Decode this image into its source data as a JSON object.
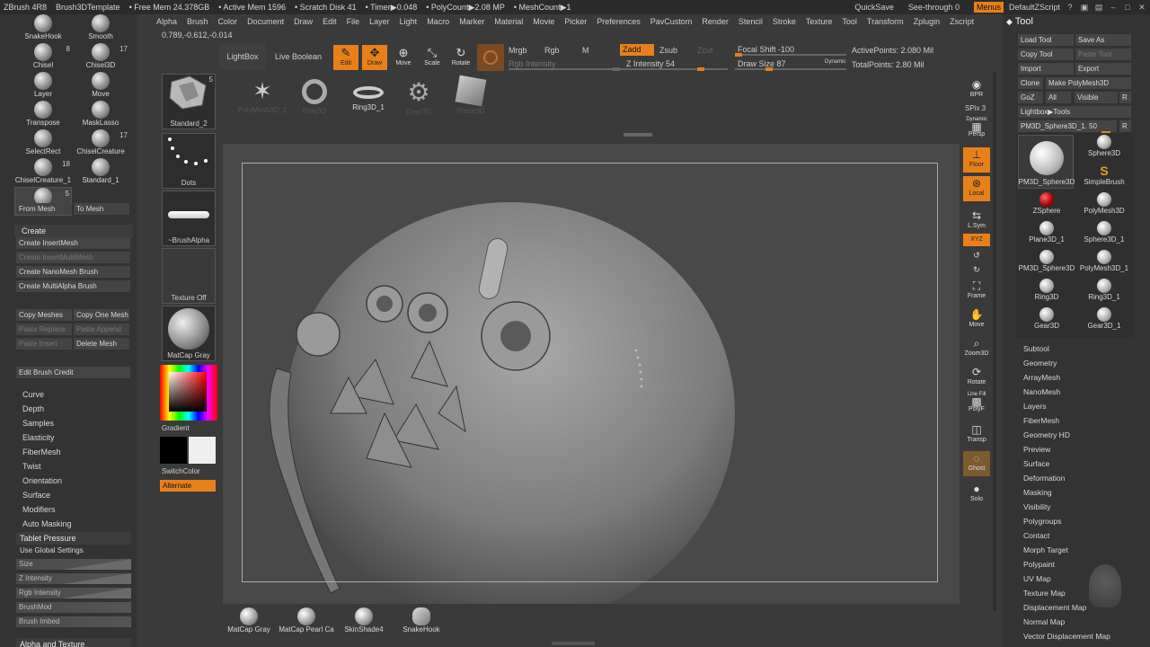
{
  "titlebar": {
    "items": [
      "ZBrush 4R8",
      "Brush3DTemplate",
      "• Free Mem 24.378GB",
      "• Active Mem 1596",
      "• Scratch Disk 41",
      "• Timer▶0.048",
      "• PolyCount▶2.08 MP",
      "• MeshCount▶1"
    ],
    "quicksave": "QuickSave",
    "seethrough": "See-through",
    "seethrough_value": "0",
    "menus": "Menus",
    "script": "DefaultZScript",
    "accent": "#e8801a"
  },
  "menubar": [
    "Alpha",
    "Brush",
    "Color",
    "Document",
    "Draw",
    "Edit",
    "File",
    "Layer",
    "Light",
    "Macro",
    "Marker",
    "Material",
    "Movie",
    "Picker",
    "Preferences",
    "PavCustom",
    "Render",
    "Stencil",
    "Stroke",
    "Texture",
    "Tool",
    "Transform",
    "Zplugin",
    "Zscript"
  ],
  "coords": "0.789,-0.612,-0.014",
  "left": {
    "brushes": [
      {
        "label": "SnakeHook",
        "count": ""
      },
      {
        "label": "Smooth",
        "count": ""
      },
      {
        "label": "Chisel",
        "count": "8"
      },
      {
        "label": "Chisel3D",
        "count": "17"
      },
      {
        "label": "Layer",
        "count": ""
      },
      {
        "label": "Move",
        "count": ""
      },
      {
        "label": "Transpose",
        "count": ""
      },
      {
        "label": "MaskLasso",
        "count": ""
      },
      {
        "label": "SelectRect",
        "count": ""
      },
      {
        "label": "ChiselCreature",
        "count": "17"
      },
      {
        "label": "ChiselCreature_1",
        "count": "18"
      },
      {
        "label": "Standard_1",
        "count": ""
      },
      {
        "label": "Standard_2",
        "count": "5"
      }
    ],
    "from_mesh": "From Mesh",
    "to_mesh": "To Mesh",
    "create_header": "Create",
    "create_insert_mesh": "Create InsertMesh",
    "create_insert_multimesh": "Create InsertMultiMesh",
    "create_nanomesh": "Create NanoMesh Brush",
    "create_multialpha": "Create MultiAlpha Brush",
    "copy_meshes": "Copy Meshes",
    "copy_one_mesh": "Copy One Mesh",
    "paste_replace": "Paste Replace",
    "paste_append": "Paste Append",
    "paste_insert": "Paste Insert",
    "delete_mesh": "Delete Mesh",
    "edit_brush_credit": "Edit Brush Credit",
    "sections": [
      "Curve",
      "Depth",
      "Samples",
      "Elasticity",
      "FiberMesh",
      "Twist",
      "Orientation",
      "Surface",
      "Modifiers",
      "Auto Masking"
    ],
    "tablet_pressure": "Tablet Pressure",
    "use_global": "Use Global Settings",
    "pressure_sliders": [
      "Size",
      "Z Intensity",
      "Rgb Intensity",
      "BrushMod",
      "Brush Imbed"
    ],
    "alpha_texture": "Alpha and Texture"
  },
  "swatches": {
    "brush": "Standard_2",
    "brush_count": "5",
    "stroke": "Dots",
    "alpha": "~BrushAlpha",
    "texture": "Texture Off",
    "material": "MatCap Gray",
    "gradient": "Gradient",
    "switchcolor": "SwitchColor",
    "alternate": "Alternate"
  },
  "toolbar": {
    "lightbox": "LightBox",
    "live_boolean": "Live Boolean",
    "edit": "Edit",
    "draw": "Draw",
    "move": "Move",
    "scale": "Scale",
    "rotate": "Rotate",
    "mrgb": "Mrgb",
    "rgb": "Rgb",
    "m": "M",
    "rgb_intensity": "Rgb Intensity",
    "zadd": "Zadd",
    "zsub": "Zsub",
    "zcut": "Zcut",
    "z_intensity": "Z Intensity 54",
    "focal_shift": "Focal Shift -100",
    "draw_size": "Draw Size 87",
    "dynamic": "Dynamic",
    "active_points": "ActivePoints: 2.080 Mil",
    "total_points": "TotalPoints: 2.80 Mil"
  },
  "shelf": [
    "PolyMesh3D_1",
    "Ring3D",
    "Ring3D_1",
    "Gear3D",
    "Plane3D"
  ],
  "right_toolbar": {
    "bpr": "BPR",
    "spix": "SPix 3",
    "dynamic": "Dynamic",
    "persp": "Persp",
    "floor": "Floor",
    "local": "Local",
    "lsym": "L.Sym",
    "xyz": "XYZ",
    "frame": "Frame",
    "move": "Move",
    "zoom3d": "Zoom3D",
    "rotate": "Rotate",
    "linefill": "Line Fill",
    "polyf": "PolyF",
    "transp": "Transp",
    "ghost": "Ghost",
    "solo": "Solo"
  },
  "tool": {
    "title": "Tool",
    "load_tool": "Load Tool",
    "save_as": "Save As",
    "copy_tool": "Copy Tool",
    "paste_tool": "Paste Tool",
    "import": "Import",
    "export": "Export",
    "clone": "Clone",
    "make_polymesh": "Make PolyMesh3D",
    "goz": "GoZ",
    "all": "All",
    "visible": "Visible",
    "r": "R",
    "lightbox_tools": "Lightbox▶Tools",
    "current_tool": "PM3D_Sphere3D_1. 50",
    "thumbs": [
      "PM3D_Sphere3D",
      "Sphere3D",
      "SimpleBrush",
      "ZSphere",
      "PolyMesh3D",
      "Plane3D_1",
      "Sphere3D_1",
      "PM3D_Sphere3D",
      "PolyMesh3D_1",
      "Ring3D",
      "Ring3D_1",
      "Gear3D",
      "Gear3D_1"
    ],
    "sections": [
      "Subtool",
      "Geometry",
      "ArrayMesh",
      "NanoMesh",
      "Layers",
      "FiberMesh",
      "Geometry HD",
      "Preview",
      "Surface",
      "Deformation",
      "Masking",
      "Visibility",
      "Polygroups",
      "Contact",
      "Morph Target",
      "Polypaint",
      "UV Map",
      "Texture Map",
      "Displacement Map",
      "Normal Map",
      "Vector Displacement Map"
    ]
  },
  "materials": [
    "MatCap Gray",
    "MatCap Pearl Ca",
    "SkinShade4",
    "SnakeHook"
  ]
}
